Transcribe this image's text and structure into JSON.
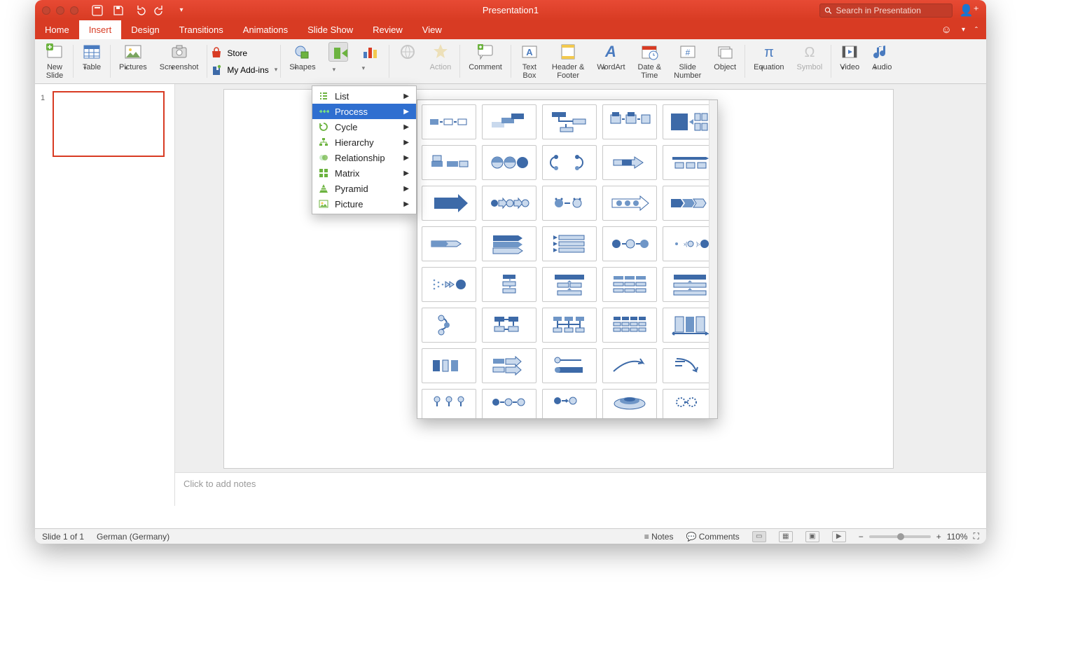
{
  "titlebar": {
    "title": "Presentation1",
    "search_placeholder": "Search in Presentation"
  },
  "tabs": [
    "Home",
    "Insert",
    "Design",
    "Transitions",
    "Animations",
    "Slide Show",
    "Review",
    "View"
  ],
  "active_tab": "Insert",
  "ribbon": {
    "new_slide": "New\nSlide",
    "table": "Table",
    "pictures": "Pictures",
    "screenshot": "Screenshot",
    "store": "Store",
    "my_addins": "My Add-ins",
    "shapes": "Shapes",
    "action": "Action",
    "comment": "Comment",
    "textbox": "Text\nBox",
    "header_footer": "Header &\nFooter",
    "wordart": "WordArt",
    "datetime": "Date &\nTime",
    "slide_number": "Slide\nNumber",
    "object": "Object",
    "equation": "Equation",
    "symbol": "Symbol",
    "video": "Video",
    "audio": "Audio"
  },
  "smartart_menu": [
    "List",
    "Process",
    "Cycle",
    "Hierarchy",
    "Relationship",
    "Matrix",
    "Pyramid",
    "Picture"
  ],
  "smartart_selected": "Process",
  "thumbs": {
    "slide_number": "1"
  },
  "notes_placeholder": "Click to add notes",
  "status": {
    "slide_of": "Slide 1 of 1",
    "language": "German (Germany)",
    "notes": "Notes",
    "comments": "Comments",
    "zoom": "110%"
  }
}
